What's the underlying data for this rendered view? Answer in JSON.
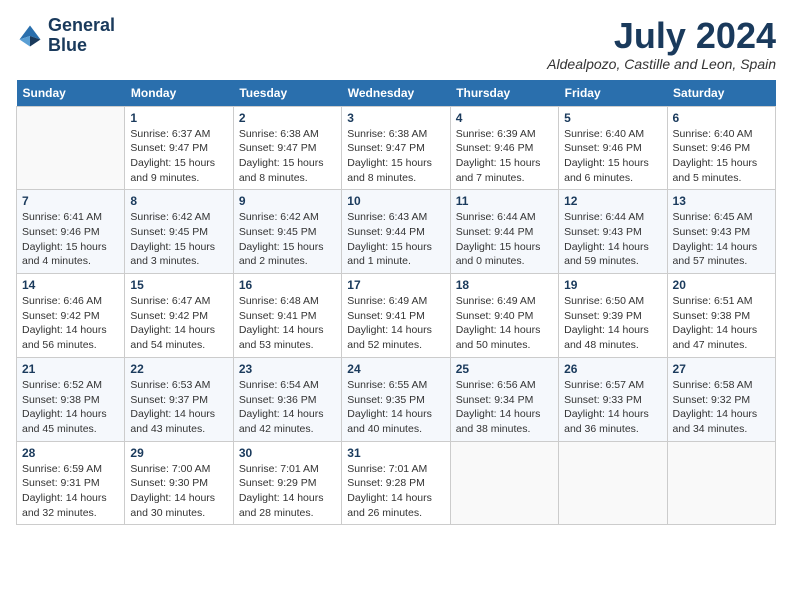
{
  "header": {
    "logo_line1": "General",
    "logo_line2": "Blue",
    "month_title": "July 2024",
    "location": "Aldealpozo, Castille and Leon, Spain"
  },
  "weekdays": [
    "Sunday",
    "Monday",
    "Tuesday",
    "Wednesday",
    "Thursday",
    "Friday",
    "Saturday"
  ],
  "weeks": [
    [
      {
        "day": "",
        "info": ""
      },
      {
        "day": "1",
        "info": "Sunrise: 6:37 AM\nSunset: 9:47 PM\nDaylight: 15 hours\nand 9 minutes."
      },
      {
        "day": "2",
        "info": "Sunrise: 6:38 AM\nSunset: 9:47 PM\nDaylight: 15 hours\nand 8 minutes."
      },
      {
        "day": "3",
        "info": "Sunrise: 6:38 AM\nSunset: 9:47 PM\nDaylight: 15 hours\nand 8 minutes."
      },
      {
        "day": "4",
        "info": "Sunrise: 6:39 AM\nSunset: 9:46 PM\nDaylight: 15 hours\nand 7 minutes."
      },
      {
        "day": "5",
        "info": "Sunrise: 6:40 AM\nSunset: 9:46 PM\nDaylight: 15 hours\nand 6 minutes."
      },
      {
        "day": "6",
        "info": "Sunrise: 6:40 AM\nSunset: 9:46 PM\nDaylight: 15 hours\nand 5 minutes."
      }
    ],
    [
      {
        "day": "7",
        "info": "Sunrise: 6:41 AM\nSunset: 9:46 PM\nDaylight: 15 hours\nand 4 minutes."
      },
      {
        "day": "8",
        "info": "Sunrise: 6:42 AM\nSunset: 9:45 PM\nDaylight: 15 hours\nand 3 minutes."
      },
      {
        "day": "9",
        "info": "Sunrise: 6:42 AM\nSunset: 9:45 PM\nDaylight: 15 hours\nand 2 minutes."
      },
      {
        "day": "10",
        "info": "Sunrise: 6:43 AM\nSunset: 9:44 PM\nDaylight: 15 hours\nand 1 minute."
      },
      {
        "day": "11",
        "info": "Sunrise: 6:44 AM\nSunset: 9:44 PM\nDaylight: 15 hours\nand 0 minutes."
      },
      {
        "day": "12",
        "info": "Sunrise: 6:44 AM\nSunset: 9:43 PM\nDaylight: 14 hours\nand 59 minutes."
      },
      {
        "day": "13",
        "info": "Sunrise: 6:45 AM\nSunset: 9:43 PM\nDaylight: 14 hours\nand 57 minutes."
      }
    ],
    [
      {
        "day": "14",
        "info": "Sunrise: 6:46 AM\nSunset: 9:42 PM\nDaylight: 14 hours\nand 56 minutes."
      },
      {
        "day": "15",
        "info": "Sunrise: 6:47 AM\nSunset: 9:42 PM\nDaylight: 14 hours\nand 54 minutes."
      },
      {
        "day": "16",
        "info": "Sunrise: 6:48 AM\nSunset: 9:41 PM\nDaylight: 14 hours\nand 53 minutes."
      },
      {
        "day": "17",
        "info": "Sunrise: 6:49 AM\nSunset: 9:41 PM\nDaylight: 14 hours\nand 52 minutes."
      },
      {
        "day": "18",
        "info": "Sunrise: 6:49 AM\nSunset: 9:40 PM\nDaylight: 14 hours\nand 50 minutes."
      },
      {
        "day": "19",
        "info": "Sunrise: 6:50 AM\nSunset: 9:39 PM\nDaylight: 14 hours\nand 48 minutes."
      },
      {
        "day": "20",
        "info": "Sunrise: 6:51 AM\nSunset: 9:38 PM\nDaylight: 14 hours\nand 47 minutes."
      }
    ],
    [
      {
        "day": "21",
        "info": "Sunrise: 6:52 AM\nSunset: 9:38 PM\nDaylight: 14 hours\nand 45 minutes."
      },
      {
        "day": "22",
        "info": "Sunrise: 6:53 AM\nSunset: 9:37 PM\nDaylight: 14 hours\nand 43 minutes."
      },
      {
        "day": "23",
        "info": "Sunrise: 6:54 AM\nSunset: 9:36 PM\nDaylight: 14 hours\nand 42 minutes."
      },
      {
        "day": "24",
        "info": "Sunrise: 6:55 AM\nSunset: 9:35 PM\nDaylight: 14 hours\nand 40 minutes."
      },
      {
        "day": "25",
        "info": "Sunrise: 6:56 AM\nSunset: 9:34 PM\nDaylight: 14 hours\nand 38 minutes."
      },
      {
        "day": "26",
        "info": "Sunrise: 6:57 AM\nSunset: 9:33 PM\nDaylight: 14 hours\nand 36 minutes."
      },
      {
        "day": "27",
        "info": "Sunrise: 6:58 AM\nSunset: 9:32 PM\nDaylight: 14 hours\nand 34 minutes."
      }
    ],
    [
      {
        "day": "28",
        "info": "Sunrise: 6:59 AM\nSunset: 9:31 PM\nDaylight: 14 hours\nand 32 minutes."
      },
      {
        "day": "29",
        "info": "Sunrise: 7:00 AM\nSunset: 9:30 PM\nDaylight: 14 hours\nand 30 minutes."
      },
      {
        "day": "30",
        "info": "Sunrise: 7:01 AM\nSunset: 9:29 PM\nDaylight: 14 hours\nand 28 minutes."
      },
      {
        "day": "31",
        "info": "Sunrise: 7:01 AM\nSunset: 9:28 PM\nDaylight: 14 hours\nand 26 minutes."
      },
      {
        "day": "",
        "info": ""
      },
      {
        "day": "",
        "info": ""
      },
      {
        "day": "",
        "info": ""
      }
    ]
  ]
}
